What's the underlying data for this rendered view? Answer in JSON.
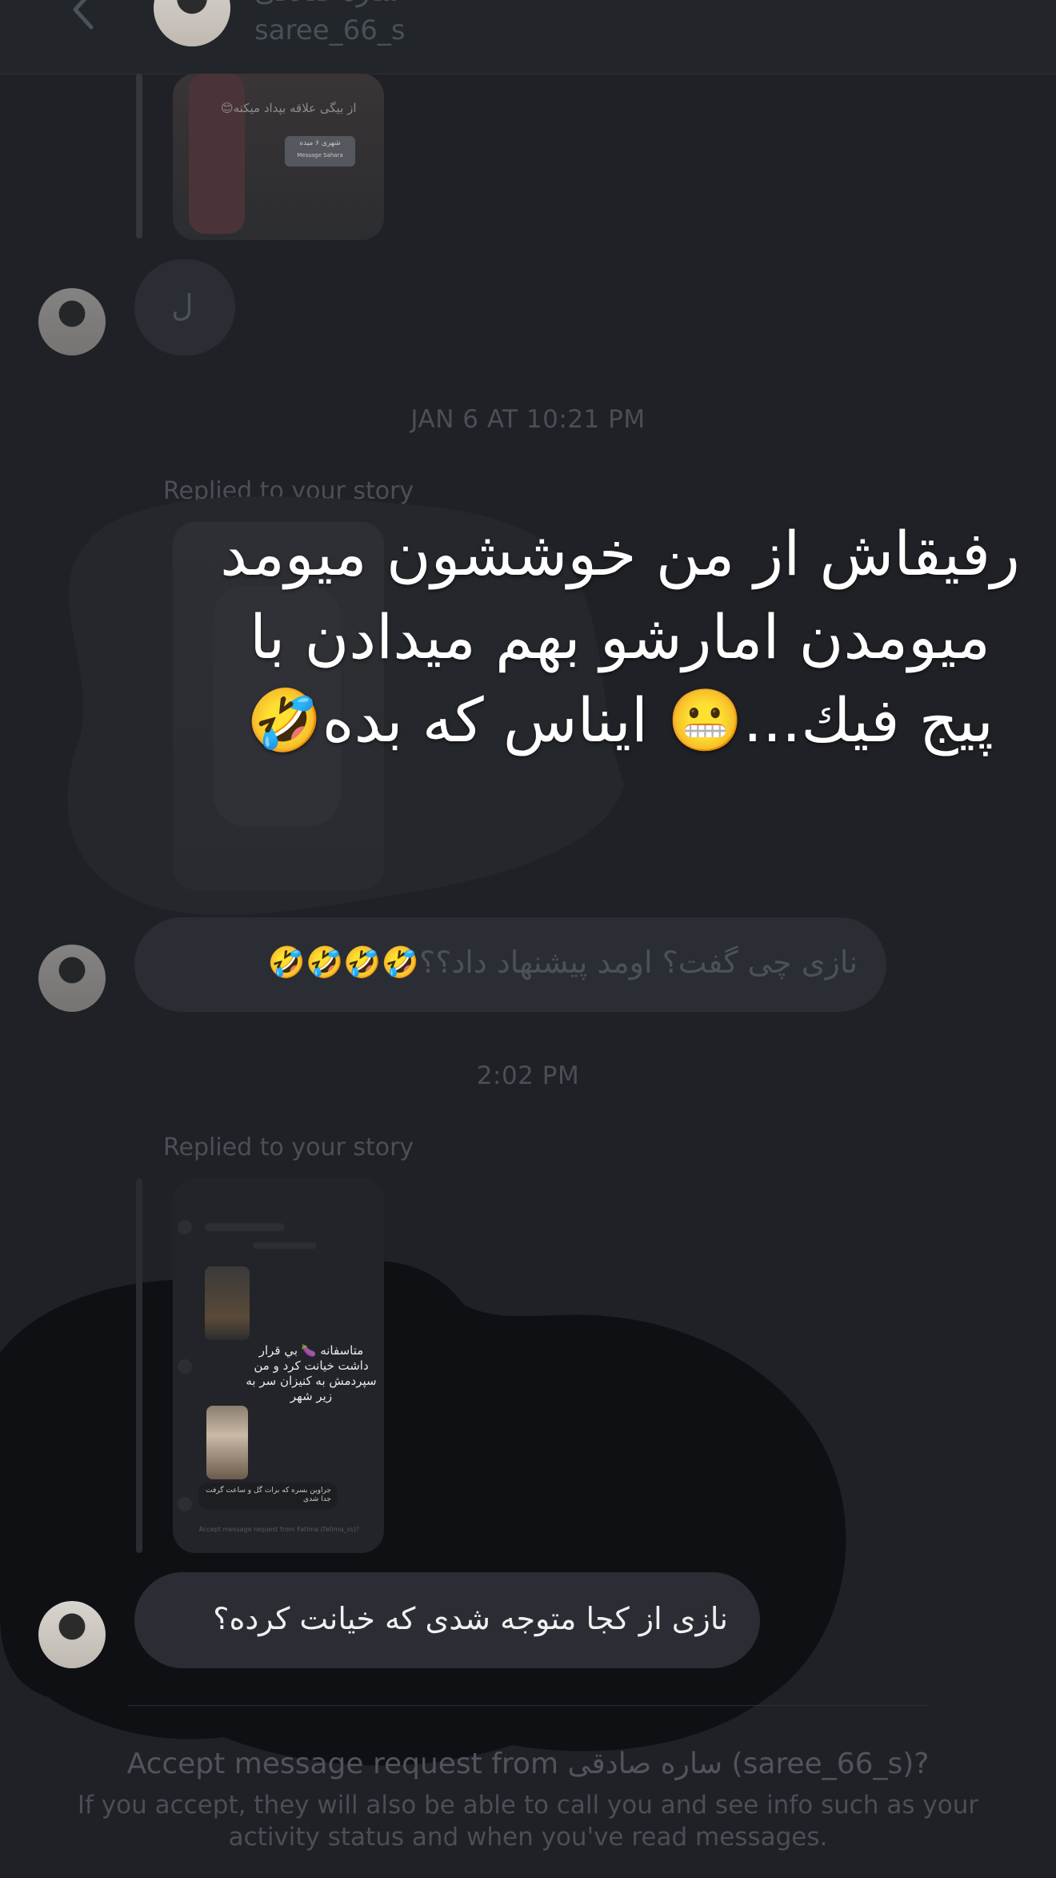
{
  "header": {
    "display_name": "ساره صادقی",
    "username": "saree_66_s"
  },
  "thread": {
    "story_1": {
      "overlay_text": "از بیگی علاقه بپداد میکنه😊",
      "card_title": "شهری ۶ میده",
      "card_action": "Message Sahara"
    },
    "message_1": "ل",
    "timestamp_1": "JAN 6 AT 10:21 PM",
    "replied_label_1": "Replied to your story",
    "story_overlay_text": "رفیقاش از من خوششون میومد میومدن امارشو بهم میدادن با پیج فیك...😬 ایناس که بده🤣",
    "message_2": "نازی چی گفت؟ اومد پیشنهاد داد؟؟🤣🤣🤣🤣",
    "timestamp_2": "2:02 PM",
    "replied_label_2": "Replied to your story",
    "story_2": {
      "caption": "متاسفانه 🍆 بي قرار داشت خيانت كرد و من سپردمش به کنیزان سر به زیر شهر",
      "bubble_small": "جراوين بسره كه برات گل و ساعت گرفت جدا شدی",
      "accept_small": "Accept message request from Fatima (fatima_ss)?"
    },
    "message_3": "نازی از کجا متوجه شدی که خیانت کرده؟"
  },
  "footer": {
    "accept_prefix": "Accept message request from ",
    "accept_name": "ساره صادقی",
    "accept_suffix": " (saree_66_s)?",
    "accept_desc": "If you accept, they will also be able to call you and see info such as your activity status and when you've read messages."
  },
  "colors": {
    "background": "#1f2126",
    "bubble": "#2a2d33",
    "dark_blob": "#0e1014"
  },
  "icons": [
    "chevron-left-icon",
    "avatar"
  ]
}
